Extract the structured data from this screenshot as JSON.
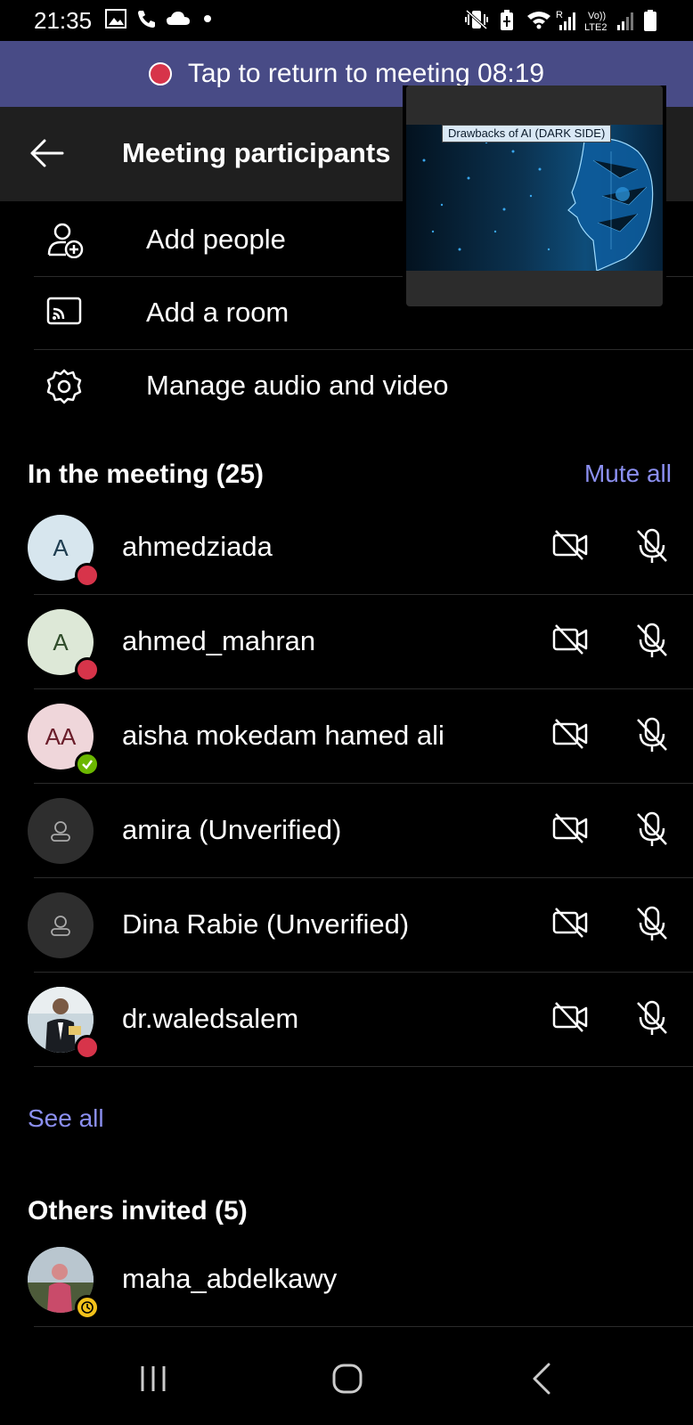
{
  "status_bar": {
    "time": "21:35",
    "left_icons": [
      "image-icon",
      "phone-icon",
      "cloud-icon",
      "dot-icon"
    ],
    "right_icons": [
      "vibrate-icon",
      "battery-saver-icon",
      "wifi-icon",
      "signal-icon",
      "volte-icon",
      "signal-icon",
      "battery-icon"
    ]
  },
  "banner": {
    "text": "Tap to return to meeting 08:19",
    "record_color": "#d7344a",
    "background": "#484b86"
  },
  "header": {
    "title": "Meeting participants"
  },
  "pip": {
    "slide_title": "Drawbacks of AI (DARK SIDE)"
  },
  "actions": [
    {
      "label": "Add people",
      "icon": "add-person-icon"
    },
    {
      "label": "Add a room",
      "icon": "cast-icon"
    },
    {
      "label": "Manage audio and video",
      "icon": "gear-icon"
    }
  ],
  "in_meeting": {
    "title": "In the meeting (25)",
    "mute_all": "Mute all",
    "participants": [
      {
        "name": "ahmedziada",
        "initials": "A",
        "avatar_bg": "#d7e6ee",
        "avatar_fg": "#1f3d50",
        "presence": "busy"
      },
      {
        "name": "ahmed_mahran",
        "initials": "A",
        "avatar_bg": "#dde8d7",
        "avatar_fg": "#2f4c2a",
        "presence": "busy"
      },
      {
        "name": "aisha mokedam hamed ali",
        "initials": "AA",
        "avatar_bg": "#efd6da",
        "avatar_fg": "#6a1d2a",
        "presence": "available"
      },
      {
        "name": "amira (Unverified)",
        "initials": "",
        "avatar_bg": "#2e2e2e",
        "avatar_fg": "#aaa",
        "presence": "none"
      },
      {
        "name": "Dina Rabie (Unverified)",
        "initials": "",
        "avatar_bg": "#2e2e2e",
        "avatar_fg": "#aaa",
        "presence": "none"
      },
      {
        "name": "dr.waledsalem",
        "initials": "",
        "avatar_bg": "#9fb6c4",
        "avatar_fg": "#fff",
        "presence": "busy"
      }
    ],
    "see_all": "See all"
  },
  "others_invited": {
    "title": "Others invited (5)",
    "participants": [
      {
        "name": "maha_abdelkawy",
        "avatar_bg": "#8a9aa6",
        "presence": "away"
      }
    ]
  },
  "colors": {
    "accent": "#8b8ff0",
    "busy": "#d7344a",
    "available": "#6bb700",
    "away": "#f4c21a"
  }
}
